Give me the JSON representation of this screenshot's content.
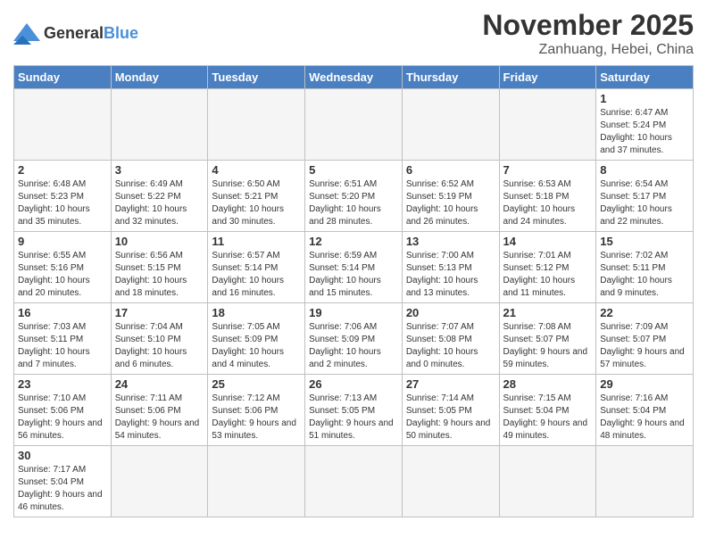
{
  "header": {
    "logo_general": "General",
    "logo_blue": "Blue",
    "month_title": "November 2025",
    "location": "Zanhuang, Hebei, China"
  },
  "days_of_week": [
    "Sunday",
    "Monday",
    "Tuesday",
    "Wednesday",
    "Thursday",
    "Friday",
    "Saturday"
  ],
  "weeks": [
    [
      {
        "num": "",
        "info": "",
        "empty": true
      },
      {
        "num": "",
        "info": "",
        "empty": true
      },
      {
        "num": "",
        "info": "",
        "empty": true
      },
      {
        "num": "",
        "info": "",
        "empty": true
      },
      {
        "num": "",
        "info": "",
        "empty": true
      },
      {
        "num": "",
        "info": "",
        "empty": true
      },
      {
        "num": "1",
        "info": "Sunrise: 6:47 AM\nSunset: 5:24 PM\nDaylight: 10 hours\nand 37 minutes.",
        "empty": false
      }
    ],
    [
      {
        "num": "2",
        "info": "Sunrise: 6:48 AM\nSunset: 5:23 PM\nDaylight: 10 hours\nand 35 minutes.",
        "empty": false
      },
      {
        "num": "3",
        "info": "Sunrise: 6:49 AM\nSunset: 5:22 PM\nDaylight: 10 hours\nand 32 minutes.",
        "empty": false
      },
      {
        "num": "4",
        "info": "Sunrise: 6:50 AM\nSunset: 5:21 PM\nDaylight: 10 hours\nand 30 minutes.",
        "empty": false
      },
      {
        "num": "5",
        "info": "Sunrise: 6:51 AM\nSunset: 5:20 PM\nDaylight: 10 hours\nand 28 minutes.",
        "empty": false
      },
      {
        "num": "6",
        "info": "Sunrise: 6:52 AM\nSunset: 5:19 PM\nDaylight: 10 hours\nand 26 minutes.",
        "empty": false
      },
      {
        "num": "7",
        "info": "Sunrise: 6:53 AM\nSunset: 5:18 PM\nDaylight: 10 hours\nand 24 minutes.",
        "empty": false
      },
      {
        "num": "8",
        "info": "Sunrise: 6:54 AM\nSunset: 5:17 PM\nDaylight: 10 hours\nand 22 minutes.",
        "empty": false
      }
    ],
    [
      {
        "num": "9",
        "info": "Sunrise: 6:55 AM\nSunset: 5:16 PM\nDaylight: 10 hours\nand 20 minutes.",
        "empty": false
      },
      {
        "num": "10",
        "info": "Sunrise: 6:56 AM\nSunset: 5:15 PM\nDaylight: 10 hours\nand 18 minutes.",
        "empty": false
      },
      {
        "num": "11",
        "info": "Sunrise: 6:57 AM\nSunset: 5:14 PM\nDaylight: 10 hours\nand 16 minutes.",
        "empty": false
      },
      {
        "num": "12",
        "info": "Sunrise: 6:59 AM\nSunset: 5:14 PM\nDaylight: 10 hours\nand 15 minutes.",
        "empty": false
      },
      {
        "num": "13",
        "info": "Sunrise: 7:00 AM\nSunset: 5:13 PM\nDaylight: 10 hours\nand 13 minutes.",
        "empty": false
      },
      {
        "num": "14",
        "info": "Sunrise: 7:01 AM\nSunset: 5:12 PM\nDaylight: 10 hours\nand 11 minutes.",
        "empty": false
      },
      {
        "num": "15",
        "info": "Sunrise: 7:02 AM\nSunset: 5:11 PM\nDaylight: 10 hours\nand 9 minutes.",
        "empty": false
      }
    ],
    [
      {
        "num": "16",
        "info": "Sunrise: 7:03 AM\nSunset: 5:11 PM\nDaylight: 10 hours\nand 7 minutes.",
        "empty": false
      },
      {
        "num": "17",
        "info": "Sunrise: 7:04 AM\nSunset: 5:10 PM\nDaylight: 10 hours\nand 6 minutes.",
        "empty": false
      },
      {
        "num": "18",
        "info": "Sunrise: 7:05 AM\nSunset: 5:09 PM\nDaylight: 10 hours\nand 4 minutes.",
        "empty": false
      },
      {
        "num": "19",
        "info": "Sunrise: 7:06 AM\nSunset: 5:09 PM\nDaylight: 10 hours\nand 2 minutes.",
        "empty": false
      },
      {
        "num": "20",
        "info": "Sunrise: 7:07 AM\nSunset: 5:08 PM\nDaylight: 10 hours\nand 0 minutes.",
        "empty": false
      },
      {
        "num": "21",
        "info": "Sunrise: 7:08 AM\nSunset: 5:07 PM\nDaylight: 9 hours\nand 59 minutes.",
        "empty": false
      },
      {
        "num": "22",
        "info": "Sunrise: 7:09 AM\nSunset: 5:07 PM\nDaylight: 9 hours\nand 57 minutes.",
        "empty": false
      }
    ],
    [
      {
        "num": "23",
        "info": "Sunrise: 7:10 AM\nSunset: 5:06 PM\nDaylight: 9 hours\nand 56 minutes.",
        "empty": false
      },
      {
        "num": "24",
        "info": "Sunrise: 7:11 AM\nSunset: 5:06 PM\nDaylight: 9 hours\nand 54 minutes.",
        "empty": false
      },
      {
        "num": "25",
        "info": "Sunrise: 7:12 AM\nSunset: 5:06 PM\nDaylight: 9 hours\nand 53 minutes.",
        "empty": false
      },
      {
        "num": "26",
        "info": "Sunrise: 7:13 AM\nSunset: 5:05 PM\nDaylight: 9 hours\nand 51 minutes.",
        "empty": false
      },
      {
        "num": "27",
        "info": "Sunrise: 7:14 AM\nSunset: 5:05 PM\nDaylight: 9 hours\nand 50 minutes.",
        "empty": false
      },
      {
        "num": "28",
        "info": "Sunrise: 7:15 AM\nSunset: 5:04 PM\nDaylight: 9 hours\nand 49 minutes.",
        "empty": false
      },
      {
        "num": "29",
        "info": "Sunrise: 7:16 AM\nSunset: 5:04 PM\nDaylight: 9 hours\nand 48 minutes.",
        "empty": false
      }
    ],
    [
      {
        "num": "30",
        "info": "Sunrise: 7:17 AM\nSunset: 5:04 PM\nDaylight: 9 hours\nand 46 minutes.",
        "empty": false
      },
      {
        "num": "",
        "info": "",
        "empty": true
      },
      {
        "num": "",
        "info": "",
        "empty": true
      },
      {
        "num": "",
        "info": "",
        "empty": true
      },
      {
        "num": "",
        "info": "",
        "empty": true
      },
      {
        "num": "",
        "info": "",
        "empty": true
      },
      {
        "num": "",
        "info": "",
        "empty": true
      }
    ]
  ]
}
